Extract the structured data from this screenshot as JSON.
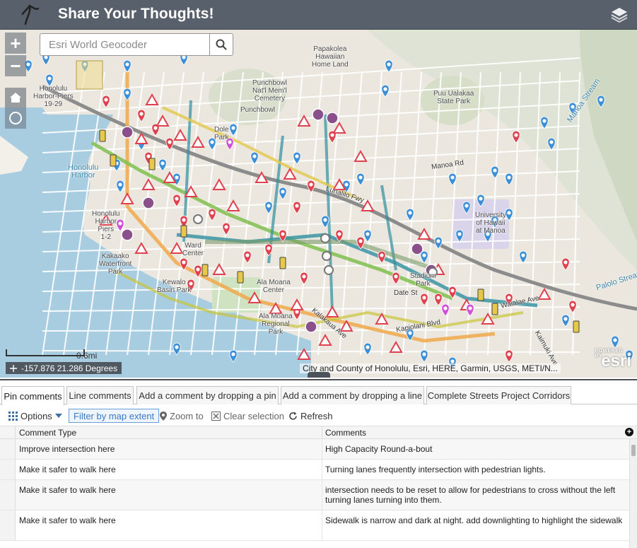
{
  "app": {
    "title": "Share Your Thoughts!"
  },
  "search": {
    "placeholder": "Esri World Geocoder"
  },
  "map": {
    "scale_label": "0.6mi",
    "coordinates": "-157.876 21.286 Degrees",
    "attribution": "City and County of Honolulu, Esri, HERE, Garmin, USGS, METI/N...",
    "esri_powered": "POWERED BY",
    "esri_logo": "esri",
    "labels": [
      {
        "text": "Honolulu\nHarbor",
        "cls": "water"
      },
      {
        "text": "Punchbowl\nNat'l Mem'l\nCemetery",
        "cls": ""
      },
      {
        "text": "Punchbowl",
        "cls": ""
      },
      {
        "text": "Papakolea\nHawaiian\nHome Land",
        "cls": ""
      },
      {
        "text": "Puu Ualakaa\nState Park",
        "cls": ""
      },
      {
        "text": "Honolulu\nHarbor-Piers\n19-29",
        "cls": ""
      },
      {
        "text": "Honolulu\nHarbor\nPiers\n1-2",
        "cls": ""
      },
      {
        "text": "Kakaako\nWaterfront\nPark",
        "cls": ""
      },
      {
        "text": "Kewalo\nBasin Park",
        "cls": ""
      },
      {
        "text": "Ala Moana\nCenter",
        "cls": ""
      },
      {
        "text": "Ala Moana\nRegional\nPark",
        "cls": ""
      },
      {
        "text": "Ward\nCenter",
        "cls": ""
      },
      {
        "text": "Dole\nPark",
        "cls": ""
      },
      {
        "text": "University\nof Hawaii\nat Manoa",
        "cls": ""
      },
      {
        "text": "Stadium\nPark",
        "cls": ""
      },
      {
        "text": "Palolo Stream",
        "cls": "water"
      },
      {
        "text": "Manoa Stream",
        "cls": "water"
      },
      {
        "text": "Lunalilo Fwy",
        "cls": "street"
      },
      {
        "text": "Kalakaua Ave",
        "cls": "street"
      },
      {
        "text": "Waialae Ave",
        "cls": "street"
      },
      {
        "text": "Kaimuki Ave",
        "cls": "street"
      },
      {
        "text": "Manoa Rd",
        "cls": "street"
      },
      {
        "text": "Date St",
        "cls": "street"
      },
      {
        "text": "Kapiolani Blvd",
        "cls": "street"
      }
    ]
  },
  "tabs": [
    {
      "label": "Pin comments",
      "active": true
    },
    {
      "label": "Line comments",
      "active": false
    },
    {
      "label": "Add a comment by dropping a pin",
      "active": false
    },
    {
      "label": "Add a comment by dropping a line",
      "active": false
    },
    {
      "label": "Complete Streets Project Corridors",
      "active": false
    }
  ],
  "toolbar": {
    "options": "Options",
    "filter": "Filter by map extent",
    "zoom_to": "Zoom to",
    "clear_selection": "Clear selection",
    "refresh": "Refresh"
  },
  "table": {
    "columns": [
      "Comment Type",
      "Comments"
    ],
    "rows": [
      {
        "type": "Improve intersection here",
        "comment": "High Capacity Round-a-bout"
      },
      {
        "type": "Make it safer to walk here",
        "comment": "Turning lanes frequently intersection with pedestrian lights."
      },
      {
        "type": "Make it safer to walk here",
        "comment": "intersection needs to be reset to allow for pedestrians to cross without the left turning lanes turning into them."
      },
      {
        "type": "Make it safer to walk here",
        "comment": "Sidewalk is narrow and dark at night. add downlighting to highlight the sidewalk"
      }
    ]
  },
  "colors": {
    "header_bg": "#58606b",
    "pin_blue": "#3c8fd6",
    "pin_red": "#e0414e",
    "pin_purple": "#8b4f8c",
    "pin_magenta": "#d04fd8",
    "water": "#a9cde0",
    "corridor_green": "#7fbf4d",
    "corridor_orange": "#f0a84a",
    "corridor_teal": "#2e8ea0"
  }
}
